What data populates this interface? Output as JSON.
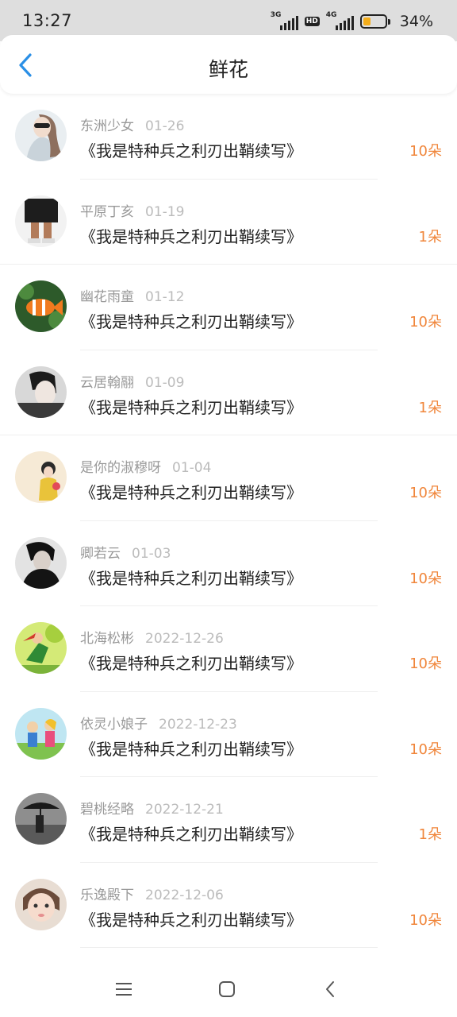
{
  "status_bar": {
    "time": "13:27",
    "signal_1": "3G",
    "hd_badge": "HD",
    "signal_2": "4G",
    "battery_percent": "34%",
    "battery_level": 0.34,
    "battery_color": "#f3ad1b",
    "icons": [
      "signal-3g-icon",
      "hd-icon",
      "signal-4g-icon",
      "battery-icon"
    ]
  },
  "header": {
    "title": "鲜花",
    "back_icon": "chevron-left-icon",
    "accent_color": "#2a8fe6"
  },
  "list": {
    "count_color": "#f0863b",
    "items": [
      {
        "user": "东洲少女",
        "date": "01-26",
        "book": "《我是特种兵之利刃出鞘续写》",
        "count": "10朵"
      },
      {
        "user": "平原丁亥",
        "date": "01-19",
        "book": "《我是特种兵之利刃出鞘续写》",
        "count": "1朵"
      },
      {
        "user": "幽花雨童",
        "date": "01-12",
        "book": "《我是特种兵之利刃出鞘续写》",
        "count": "10朵"
      },
      {
        "user": "云居翰翮",
        "date": "01-09",
        "book": "《我是特种兵之利刃出鞘续写》",
        "count": "1朵"
      },
      {
        "user": "是你的淑穆呀",
        "date": "01-04",
        "book": "《我是特种兵之利刃出鞘续写》",
        "count": "10朵"
      },
      {
        "user": "卿若云",
        "date": "01-03",
        "book": "《我是特种兵之利刃出鞘续写》",
        "count": "10朵"
      },
      {
        "user": "北海松彬",
        "date": "2022-12-26",
        "book": "《我是特种兵之利刃出鞘续写》",
        "count": "10朵"
      },
      {
        "user": "依灵小娘子",
        "date": "2022-12-23",
        "book": "《我是特种兵之利刃出鞘续写》",
        "count": "10朵"
      },
      {
        "user": "碧桃经略",
        "date": "2022-12-21",
        "book": "《我是特种兵之利刃出鞘续写》",
        "count": "1朵"
      },
      {
        "user": "乐逸殿下",
        "date": "2022-12-06",
        "book": "《我是特种兵之利刃出鞘续写》",
        "count": "10朵"
      }
    ]
  },
  "navbar": {
    "icons": [
      "menu-icon",
      "home-icon",
      "back-icon"
    ]
  }
}
